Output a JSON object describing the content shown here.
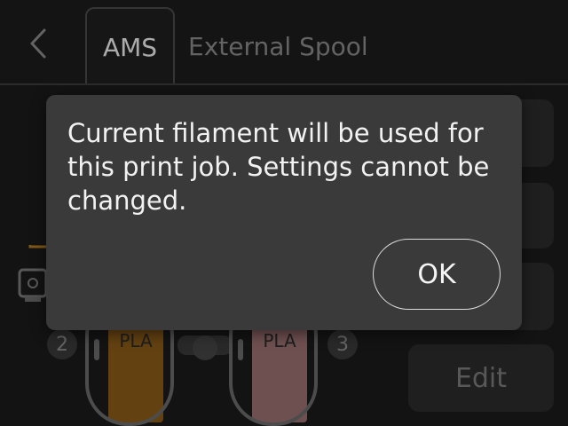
{
  "header": {
    "tabs": [
      {
        "label": "AMS",
        "active": true
      },
      {
        "label": "External Spool",
        "active": false
      }
    ]
  },
  "sidebar": {
    "edit_label": "Edit"
  },
  "ams": {
    "slots": [
      {
        "number": "2",
        "material": "PLA",
        "color": "#8a5a18"
      },
      {
        "number": "3",
        "material": "PLA",
        "color": "#9a7070"
      }
    ]
  },
  "dialog": {
    "message": "Current filament will be used for this print job. Settings cannot be changed.",
    "ok_label": "OK"
  }
}
